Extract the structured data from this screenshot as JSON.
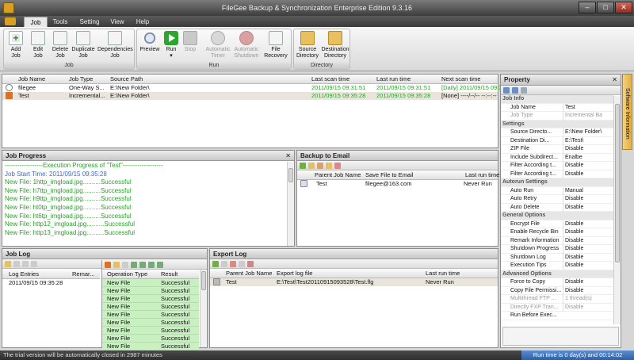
{
  "window": {
    "title": "FileGee Backup & Synchronization Enterprise Edition 9.3.16"
  },
  "menu": {
    "job": "Job",
    "tools": "Tools",
    "setting": "Setting",
    "view": "View",
    "help": "Help"
  },
  "ribbon": {
    "job": {
      "label": "Job",
      "add": [
        "Add",
        "Job"
      ],
      "edit": [
        "Edit",
        "Job"
      ],
      "delete": [
        "Delete",
        "Job"
      ],
      "duplicate": [
        "Duplicate",
        "Job"
      ],
      "dependencies": [
        "Dependencies",
        "Job"
      ]
    },
    "run": {
      "label": "Run",
      "preview": "Preview",
      "run": "Run",
      "stop": "Stop",
      "automatic_timer": [
        "Automatic",
        "Timer"
      ],
      "automatic_shutdown": [
        "Automatic",
        "Shutdown"
      ],
      "file_recovery": [
        "File",
        "Recovery"
      ]
    },
    "directory": {
      "label": "Directory",
      "source": [
        "Source",
        "Directory"
      ],
      "destination": [
        "Destination",
        "Directory"
      ]
    }
  },
  "jobs": {
    "columns": [
      "Job Name",
      "Job Type",
      "Source Path",
      "Last scan time",
      "Last run time",
      "Next scan time"
    ],
    "rows": [
      {
        "name": "filegee",
        "type": "One-Way S...",
        "source": "E:\\New Folder\\",
        "last_scan": "2011/09/15 09:31:51",
        "last_run": "2011/09/15 09:31:51",
        "next_scan": "[Daily] 2011/09/15 09:3..."
      },
      {
        "name": "Test",
        "type": "Incremental...",
        "source": "E:\\New Folder\\",
        "last_scan": "2011/09/15 09:35:28",
        "last_run": "2011/09/15 09:35:28",
        "next_scan": "[None] ----/--/-- --:--:--"
      }
    ]
  },
  "job_progress": {
    "title": "Job Progress",
    "lines": [
      "------------------Execution Progress of \"Test\"-------------------",
      "Job Start Time: 2011/09/15 09:35:28",
      "New File: 1http_imgload.jpg..........Successful",
      "New File: h7ttp_imgload.jpg..........Successful",
      "New File: h9ttp_imgload.jpg..........Successful",
      "New File: ht0tp_imgload.jpg..........Successful",
      "New File: ht6tp_imgload.jpg..........Successful",
      "New File: http12_imgload.jpg..........Successful",
      "New File: http13_imgload.jpg..........Successful"
    ]
  },
  "backup_email": {
    "title": "Backup to Email",
    "columns": [
      "Parent Job Name",
      "Save File to Email",
      "Last run time"
    ],
    "rows": [
      {
        "job": "Test",
        "email": "filegee@163.com",
        "last_run": "Never Run"
      }
    ]
  },
  "job_log": {
    "title": "Job Log",
    "columns": [
      "Log Entries",
      "Remar..."
    ],
    "rows": [
      {
        "entry": "2011/09/15 09:35:28"
      }
    ]
  },
  "operations": {
    "columns": [
      "Operation Type",
      "Result"
    ],
    "rows": [
      {
        "type": "New File",
        "result": "Successful"
      },
      {
        "type": "New File",
        "result": "Successful"
      },
      {
        "type": "New File",
        "result": "Successful"
      },
      {
        "type": "New File",
        "result": "Successful"
      },
      {
        "type": "New File",
        "result": "Successful"
      },
      {
        "type": "New File",
        "result": "Successful"
      },
      {
        "type": "New File",
        "result": "Successful"
      },
      {
        "type": "New File",
        "result": "Successful"
      },
      {
        "type": "New File",
        "result": "Successful"
      }
    ]
  },
  "export_log": {
    "title": "Export Log",
    "columns": [
      "Parent Job Name",
      "Export log file",
      "Last run time"
    ],
    "rows": [
      {
        "job": "Test",
        "file": "E:\\Test\\Test20110915093528\\Test.flg",
        "last_run": "Never Run"
      }
    ]
  },
  "property": {
    "title": "Property",
    "side_tab": "Software Information",
    "rows": [
      {
        "cat": true,
        "k": "Job Info"
      },
      {
        "k": "Job Name",
        "v": "Test"
      },
      {
        "k": "Job Type",
        "v": "Incremental Back...",
        "dim": true
      },
      {
        "cat": true,
        "k": "Settings"
      },
      {
        "k": "Source Directo...",
        "v": "E:\\New Folder\\"
      },
      {
        "k": "Destination Di...",
        "v": "E:\\Test\\"
      },
      {
        "k": "ZIP File",
        "v": "Disable"
      },
      {
        "k": "Include Subdirect...",
        "v": "Enalbe"
      },
      {
        "k": "Filter According t...",
        "v": "Disable"
      },
      {
        "k": "Filter According t...",
        "v": "Disable"
      },
      {
        "cat": true,
        "k": "Autorun Settings"
      },
      {
        "k": "Auto Run",
        "v": "Manual"
      },
      {
        "k": "Auto Retry",
        "v": "Disable"
      },
      {
        "k": "Auto Delete",
        "v": "Disable"
      },
      {
        "cat": true,
        "k": "General Options"
      },
      {
        "k": "Encrypt File",
        "v": "Disable"
      },
      {
        "k": "Enable Recycle Bin",
        "v": "Disable"
      },
      {
        "k": "Remark Information",
        "v": "Disable"
      },
      {
        "k": "Shutdown Progress",
        "v": "Disable"
      },
      {
        "k": "Shutdown Log",
        "v": "Disable"
      },
      {
        "k": "Execution Tips",
        "v": "Disable"
      },
      {
        "cat": true,
        "k": "Advanced Options"
      },
      {
        "k": "Force to Copy",
        "v": "Disable"
      },
      {
        "k": "Copy File Permissi...",
        "v": "Disable"
      },
      {
        "k": "Multithread FTP ...",
        "v": "1 thread(s)",
        "dim": true
      },
      {
        "k": "Directly FXP Tran...",
        "v": "Disable",
        "dim": true
      },
      {
        "k": "Run Before Exec...",
        "v": ""
      }
    ]
  },
  "status": {
    "message": "The trial version will be automatically closed in 2987 minutes",
    "runtime": "Run time is 0 day(s) and 00:14:02"
  }
}
